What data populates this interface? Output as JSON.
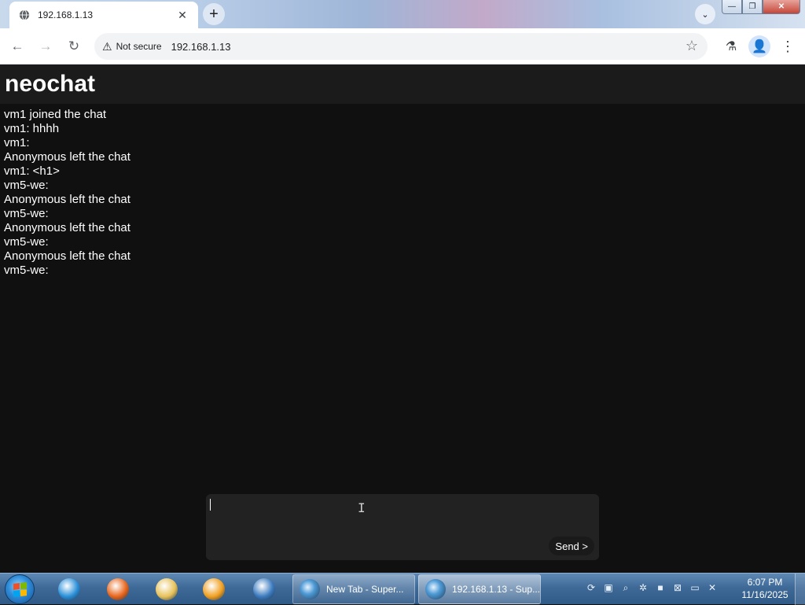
{
  "browser": {
    "tab": {
      "title": "192.168.1.13",
      "favicon": "globe-icon"
    },
    "new_tab_symbol": "+",
    "address": {
      "security_label": "Not secure",
      "url": "192.168.1.13"
    },
    "icons": {
      "back": "←",
      "forward": "→",
      "reload": "↻",
      "star": "☆",
      "labs": "⚗",
      "profile": "👤",
      "menu": "⋮",
      "close_tab": "✕",
      "tab_search": "⌄"
    },
    "window_buttons": {
      "minimize": "—",
      "restore": "❐",
      "close": "✕"
    }
  },
  "app": {
    "title": "neochat",
    "messages": [
      "vm1 joined the chat",
      "vm1: hhhh",
      "vm1: ",
      "Anonymous left the chat",
      "vm1: <h1>",
      "vm5-we: ",
      "Anonymous left the chat",
      "vm5-we: ",
      "Anonymous left the chat",
      "vm5-we: ",
      "Anonymous left the chat",
      "vm5-we: "
    ],
    "compose": {
      "value": "",
      "send_label": "Send >"
    }
  },
  "taskbar": {
    "pinned": [
      {
        "name": "internet-explorer-icon",
        "color": "#2a8fd8"
      },
      {
        "name": "firefox-icon",
        "color": "#e8651b"
      },
      {
        "name": "file-explorer-icon",
        "color": "#e7c25a"
      },
      {
        "name": "media-player-icon",
        "color": "#f0a020"
      },
      {
        "name": "chrome-browser-icon",
        "color": "#3b7bbf"
      }
    ],
    "tasks": [
      {
        "label": "New Tab - Super..."
      },
      {
        "label": "192.168.1.13 - Sup..."
      }
    ],
    "clock": {
      "time": "6:07 PM",
      "date": "11/16/2025"
    }
  },
  "colors": {
    "page_bg": "#101010",
    "header_bg": "#1b1b1b",
    "compose_bg": "#222222",
    "text": "#ffffff"
  }
}
